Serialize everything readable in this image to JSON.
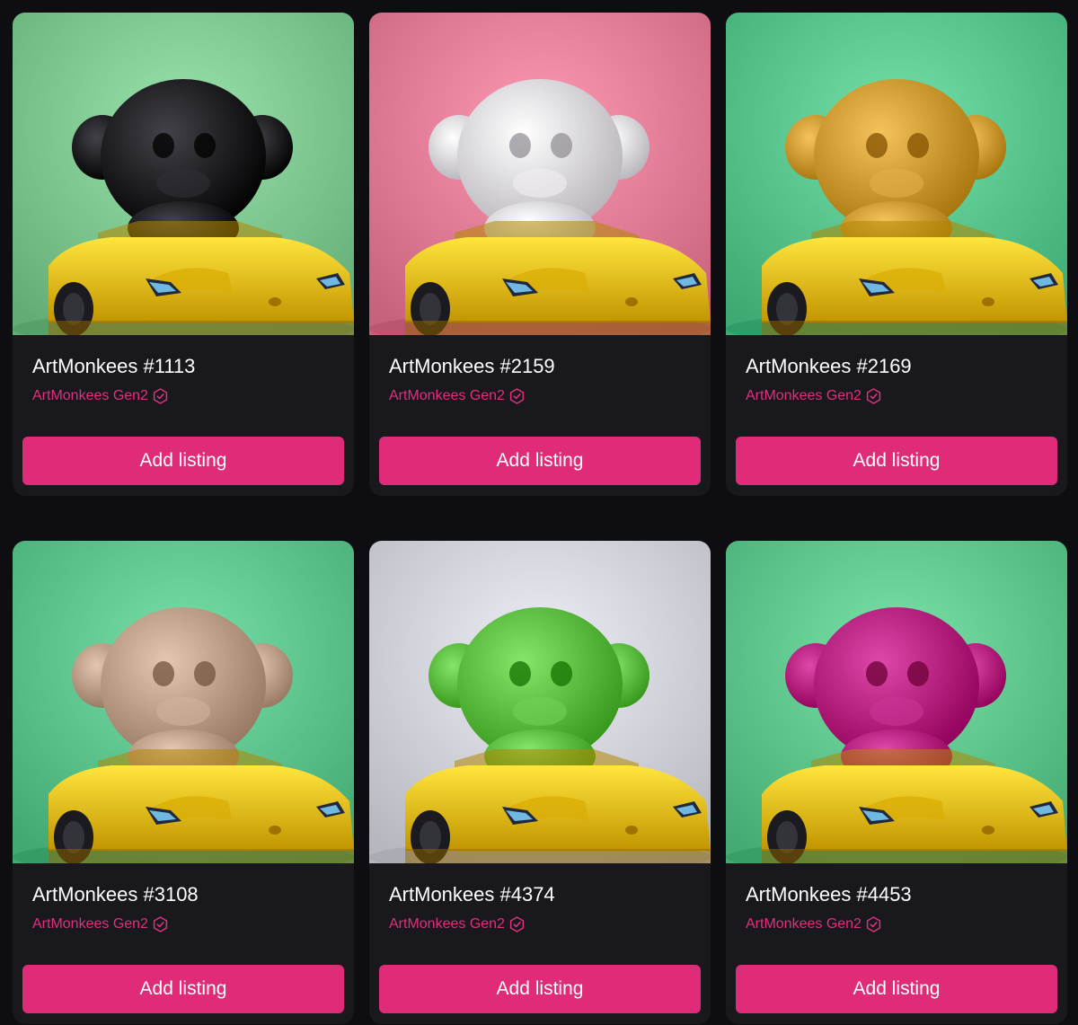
{
  "colors": {
    "page_background": "#0d0d12",
    "card_background": "#18181d",
    "accent": "#e02b78",
    "collection_text": "#e0307e",
    "title_text": "#ffffff"
  },
  "cards": [
    {
      "title": "ArtMonkees #1113",
      "collection": "ArtMonkees Gen2",
      "verified_icon": "verified-badge-icon",
      "button_label": "Add listing",
      "image_background": "#7dc58f",
      "figure_color": "#15151c",
      "car_color": "#efc21a"
    },
    {
      "title": "ArtMonkees #2159",
      "collection": "ArtMonkees Gen2",
      "verified_icon": "verified-badge-icon",
      "button_label": "Add listing",
      "image_background": "#e07b96",
      "figure_color": "#d9d6dc",
      "car_color": "#efc21a"
    },
    {
      "title": "ArtMonkees #2169",
      "collection": "ArtMonkees Gen2",
      "verified_icon": "verified-badge-icon",
      "button_label": "Add listing",
      "image_background": "#56c28c",
      "figure_color": "#c9962e",
      "car_color": "#efc21a"
    },
    {
      "title": "ArtMonkees #3108",
      "collection": "ArtMonkees Gen2",
      "verified_icon": "verified-badge-icon",
      "button_label": "Add listing",
      "image_background": "#5cc28c",
      "figure_color": "#b89a84",
      "car_color": "#efc21a"
    },
    {
      "title": "ArtMonkees #4374",
      "collection": "ArtMonkees Gen2",
      "verified_icon": "verified-badge-icon",
      "button_label": "Add listing",
      "image_background": "#cfd0d8",
      "figure_color": "#57b83c",
      "car_color": "#efc21a"
    },
    {
      "title": "ArtMonkees #4453",
      "collection": "ArtMonkees Gen2",
      "verified_icon": "verified-badge-icon",
      "button_label": "Add listing",
      "image_background": "#5dc48b",
      "figure_color": "#b21a7c",
      "car_color": "#efc21a"
    }
  ]
}
